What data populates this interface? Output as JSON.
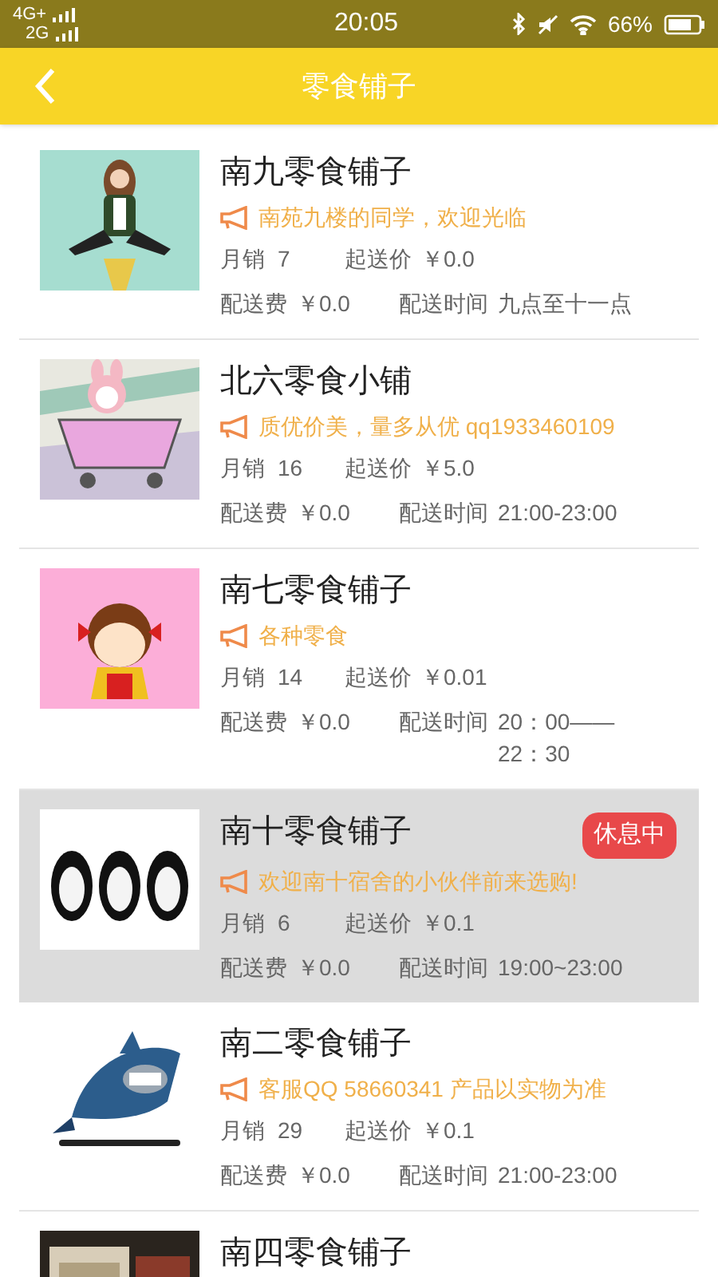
{
  "status_bar": {
    "network_1": "4G+",
    "network_2": "2G",
    "time": "20:05",
    "battery": "66%"
  },
  "header": {
    "title": "零食铺子"
  },
  "shops": [
    {
      "name": "南九零食铺子",
      "notice": "南苑九楼的同学，欢迎光临",
      "sales_label": "月销",
      "sales": "7",
      "min_label": "起送价",
      "min_price": "￥0.0",
      "fee_label": "配送费",
      "fee": "￥0.0",
      "time_label": "配送时间",
      "time": "九点至十一点",
      "resting": false
    },
    {
      "name": "北六零食小铺",
      "notice": "质优价美，量多从优 qq1933460109",
      "sales_label": "月销",
      "sales": "16",
      "min_label": "起送价",
      "min_price": "￥5.0",
      "fee_label": "配送费",
      "fee": "￥0.0",
      "time_label": "配送时间",
      "time": "21:00-23:00",
      "resting": false
    },
    {
      "name": "南七零食铺子",
      "notice": "各种零食",
      "sales_label": "月销",
      "sales": "14",
      "min_label": "起送价",
      "min_price": "￥0.01",
      "fee_label": "配送费",
      "fee": "￥0.0",
      "time_label": "配送时间",
      "time": "20：00——22：30",
      "resting": false
    },
    {
      "name": "南十零食铺子",
      "badge": "休息中",
      "notice": "欢迎南十宿舍的小伙伴前来选购!",
      "sales_label": "月销",
      "sales": "6",
      "min_label": "起送价",
      "min_price": "￥0.1",
      "fee_label": "配送费",
      "fee": "￥0.0",
      "time_label": "配送时间",
      "time": "19:00~23:00",
      "resting": true
    },
    {
      "name": "南二零食铺子",
      "notice": "客服QQ 58660341 产品以实物为准",
      "sales_label": "月销",
      "sales": "29",
      "min_label": "起送价",
      "min_price": "￥0.1",
      "fee_label": "配送费",
      "fee": "￥0.0",
      "time_label": "配送时间",
      "time": "21:00-23:00",
      "resting": false
    },
    {
      "name": "南四零食铺子",
      "resting": false
    }
  ]
}
